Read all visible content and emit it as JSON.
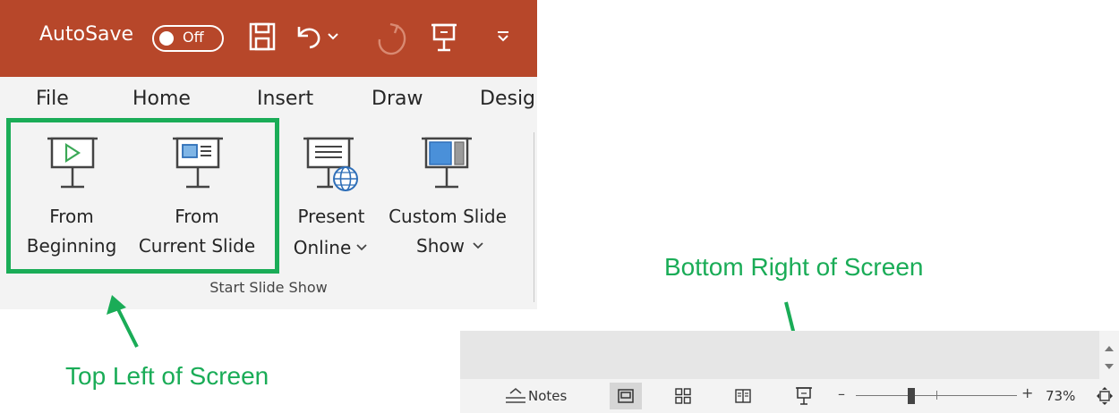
{
  "title_bar": {
    "autosave_label": "AutoSave",
    "autosave_state": "Off",
    "icons": [
      "save-icon",
      "undo-icon",
      "undo-dropdown-icon",
      "redo-icon",
      "present-icon",
      "customize-qat-icon"
    ],
    "background_color": "#b7472a"
  },
  "tabs": [
    {
      "label": "File"
    },
    {
      "label": "Home"
    },
    {
      "label": "Insert"
    },
    {
      "label": "Draw"
    },
    {
      "label": "Desig"
    }
  ],
  "ribbon": {
    "group_label": "Start Slide Show",
    "buttons": [
      {
        "line1": "From",
        "line2": "Beginning",
        "icon": "play-slide-icon"
      },
      {
        "line1": "From",
        "line2": "Current Slide",
        "icon": "current-slide-icon"
      },
      {
        "line1": "Present",
        "line2": "Online",
        "icon": "present-online-icon",
        "dropdown": true
      },
      {
        "line1": "Custom Slide",
        "line2": "Show",
        "icon": "custom-show-icon",
        "dropdown": true
      }
    ],
    "highlight_color": "#1aac57"
  },
  "annotations": {
    "top_left": "Top Left of Screen",
    "bottom_right": "Bottom Right of Screen",
    "color": "#1aac57"
  },
  "status_bar": {
    "notes_label": "Notes",
    "zoom_minus": "–",
    "zoom_plus": "+",
    "zoom_percent": "73%",
    "zoom_level": 0.73,
    "icons": [
      "notes-icon",
      "normal-view-icon",
      "slide-sorter-icon",
      "reading-view-icon",
      "slideshow-view-icon",
      "fit-slide-icon",
      "scroll-up-icon",
      "scroll-down-icon"
    ]
  }
}
